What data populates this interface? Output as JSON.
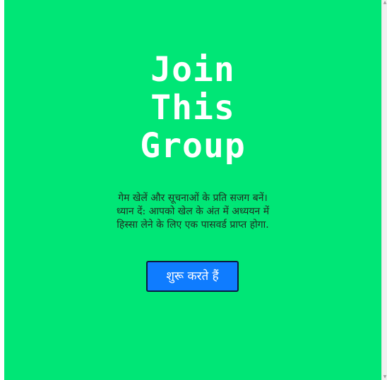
{
  "colors": {
    "background": "#00e676",
    "button": "#0f7cff",
    "title_text": "#ffffff"
  },
  "title": {
    "line1": "Join",
    "line2": "This",
    "line3": "Group"
  },
  "description": {
    "line1": "गेम खेलें और सूचनाओं के प्रति सजग बनें।",
    "line2": "ध्यान दें: आपको खेल के अंत में अध्ययन में",
    "line3": "हिस्सा लेने के लिए एक पासवर्ड प्राप्त होगा."
  },
  "button": {
    "label": "शुरू करते हैं"
  }
}
